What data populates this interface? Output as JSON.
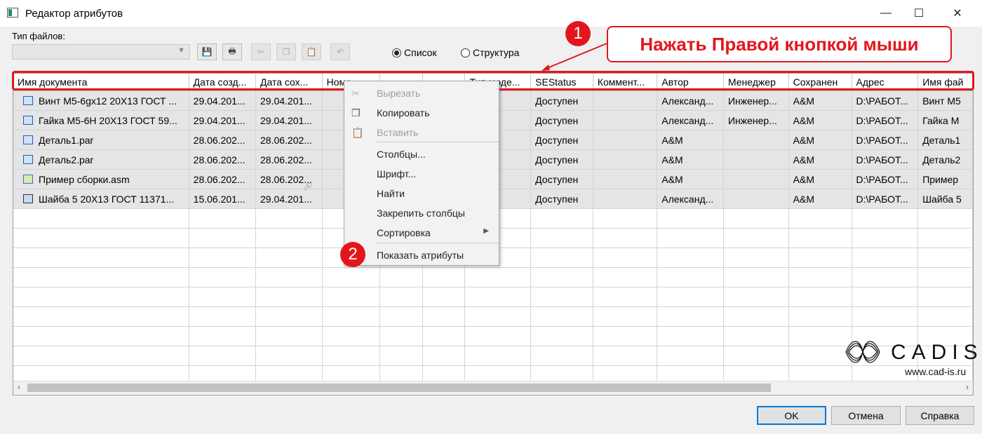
{
  "window": {
    "title": "Редактор атрибутов",
    "minimize_icon": "—",
    "maximize_icon": "☐",
    "close_icon": "✕"
  },
  "filetype": {
    "label": "Тип файлов:",
    "value": ""
  },
  "toolbar": {
    "buttons": [
      {
        "name": "save-icon",
        "glyph": "💾",
        "enabled": true
      },
      {
        "name": "print-icon",
        "glyph": "🖶",
        "enabled": true
      },
      {
        "name": "cut-icon",
        "glyph": "✂",
        "enabled": false
      },
      {
        "name": "copy-icon",
        "glyph": "❐",
        "enabled": false
      },
      {
        "name": "paste-icon",
        "glyph": "📋",
        "enabled": false
      },
      {
        "name": "undo-icon",
        "glyph": "↶",
        "enabled": false
      }
    ]
  },
  "view": {
    "list_label": "Список",
    "structure_label": "Структура",
    "selected": "list"
  },
  "callouts": {
    "one": "1",
    "two": "2",
    "instruction": "Нажать Правой кнопкой мыши",
    "color": "#e3161d"
  },
  "grid": {
    "columns": [
      "Имя документа",
      "Дата созд...",
      "Дата сох...",
      "Номе...",
      "",
      "",
      "Тип моде...",
      "SEStatus",
      "Коммент...",
      "Автор",
      "Менеджер",
      "Сохранен",
      "Адрес",
      "Имя фай"
    ],
    "sort_indicator": "△",
    "rows": [
      {
        "icon": "part",
        "cells": [
          "Винт М5-6gx12 20Х13 ГОСТ ...",
          "29.04.201...",
          "29.04.201...",
          "",
          "",
          "",
          "",
          "Доступен",
          "",
          "Александ...",
          "Инженер...",
          "A&M",
          "D:\\РАБОТ...",
          "Винт М5"
        ]
      },
      {
        "icon": "part",
        "cells": [
          "Гайка М5-6Н 20Х13 ГОСТ 59...",
          "29.04.201...",
          "29.04.201...",
          "",
          "",
          "",
          "",
          "Доступен",
          "",
          "Александ...",
          "Инженер...",
          "A&M",
          "D:\\РАБОТ...",
          "Гайка М"
        ]
      },
      {
        "icon": "part",
        "cells": [
          "Деталь1.par",
          "28.06.202...",
          "28.06.202...",
          "",
          "",
          "",
          "",
          "Доступен",
          "",
          "A&M",
          "",
          "A&M",
          "D:\\РАБОТ...",
          "Деталь1"
        ]
      },
      {
        "icon": "part",
        "cells": [
          "Деталь2.par",
          "28.06.202...",
          "28.06.202...",
          "",
          "",
          "",
          "",
          "Доступен",
          "",
          "A&M",
          "",
          "A&M",
          "D:\\РАБОТ...",
          "Деталь2"
        ]
      },
      {
        "icon": "asm",
        "cells": [
          "Пример сборки.asm",
          "28.06.202...",
          "28.06.202...",
          "",
          "",
          "",
          "",
          "Доступен",
          "",
          "A&M",
          "",
          "A&M",
          "D:\\РАБОТ...",
          "Пример"
        ]
      },
      {
        "icon": "std",
        "cells": [
          "Шайба 5 20Х13 ГОСТ 11371...",
          "15.06.201...",
          "29.04.201...",
          "",
          "",
          "",
          "",
          "Доступен",
          "",
          "Александ...",
          "",
          "A&M",
          "D:\\РАБОТ...",
          "Шайба 5"
        ]
      }
    ],
    "empty_rows": 9
  },
  "context_menu": {
    "items": [
      {
        "label": "Вырезать",
        "enabled": false,
        "icon": "cut-icon",
        "glyph": "✂"
      },
      {
        "label": "Копировать",
        "enabled": true,
        "icon": "copy-icon",
        "glyph": "❐"
      },
      {
        "label": "Вставить",
        "enabled": false,
        "icon": "paste-icon",
        "glyph": "📋"
      },
      {
        "label": "Столбцы...",
        "enabled": true
      },
      {
        "label": "Шрифт...",
        "enabled": true
      },
      {
        "label": "Найти",
        "enabled": true
      },
      {
        "label": "Закрепить столбцы",
        "enabled": true
      },
      {
        "label": "Сортировка",
        "enabled": true,
        "submenu": true
      },
      {
        "label": "Показать атрибуты",
        "enabled": true
      }
    ]
  },
  "logo": {
    "text": "CADIS",
    "url": "www.cad-is.ru"
  },
  "dialog_buttons": {
    "ok": "OK",
    "cancel": "Отмена",
    "help": "Справка"
  }
}
